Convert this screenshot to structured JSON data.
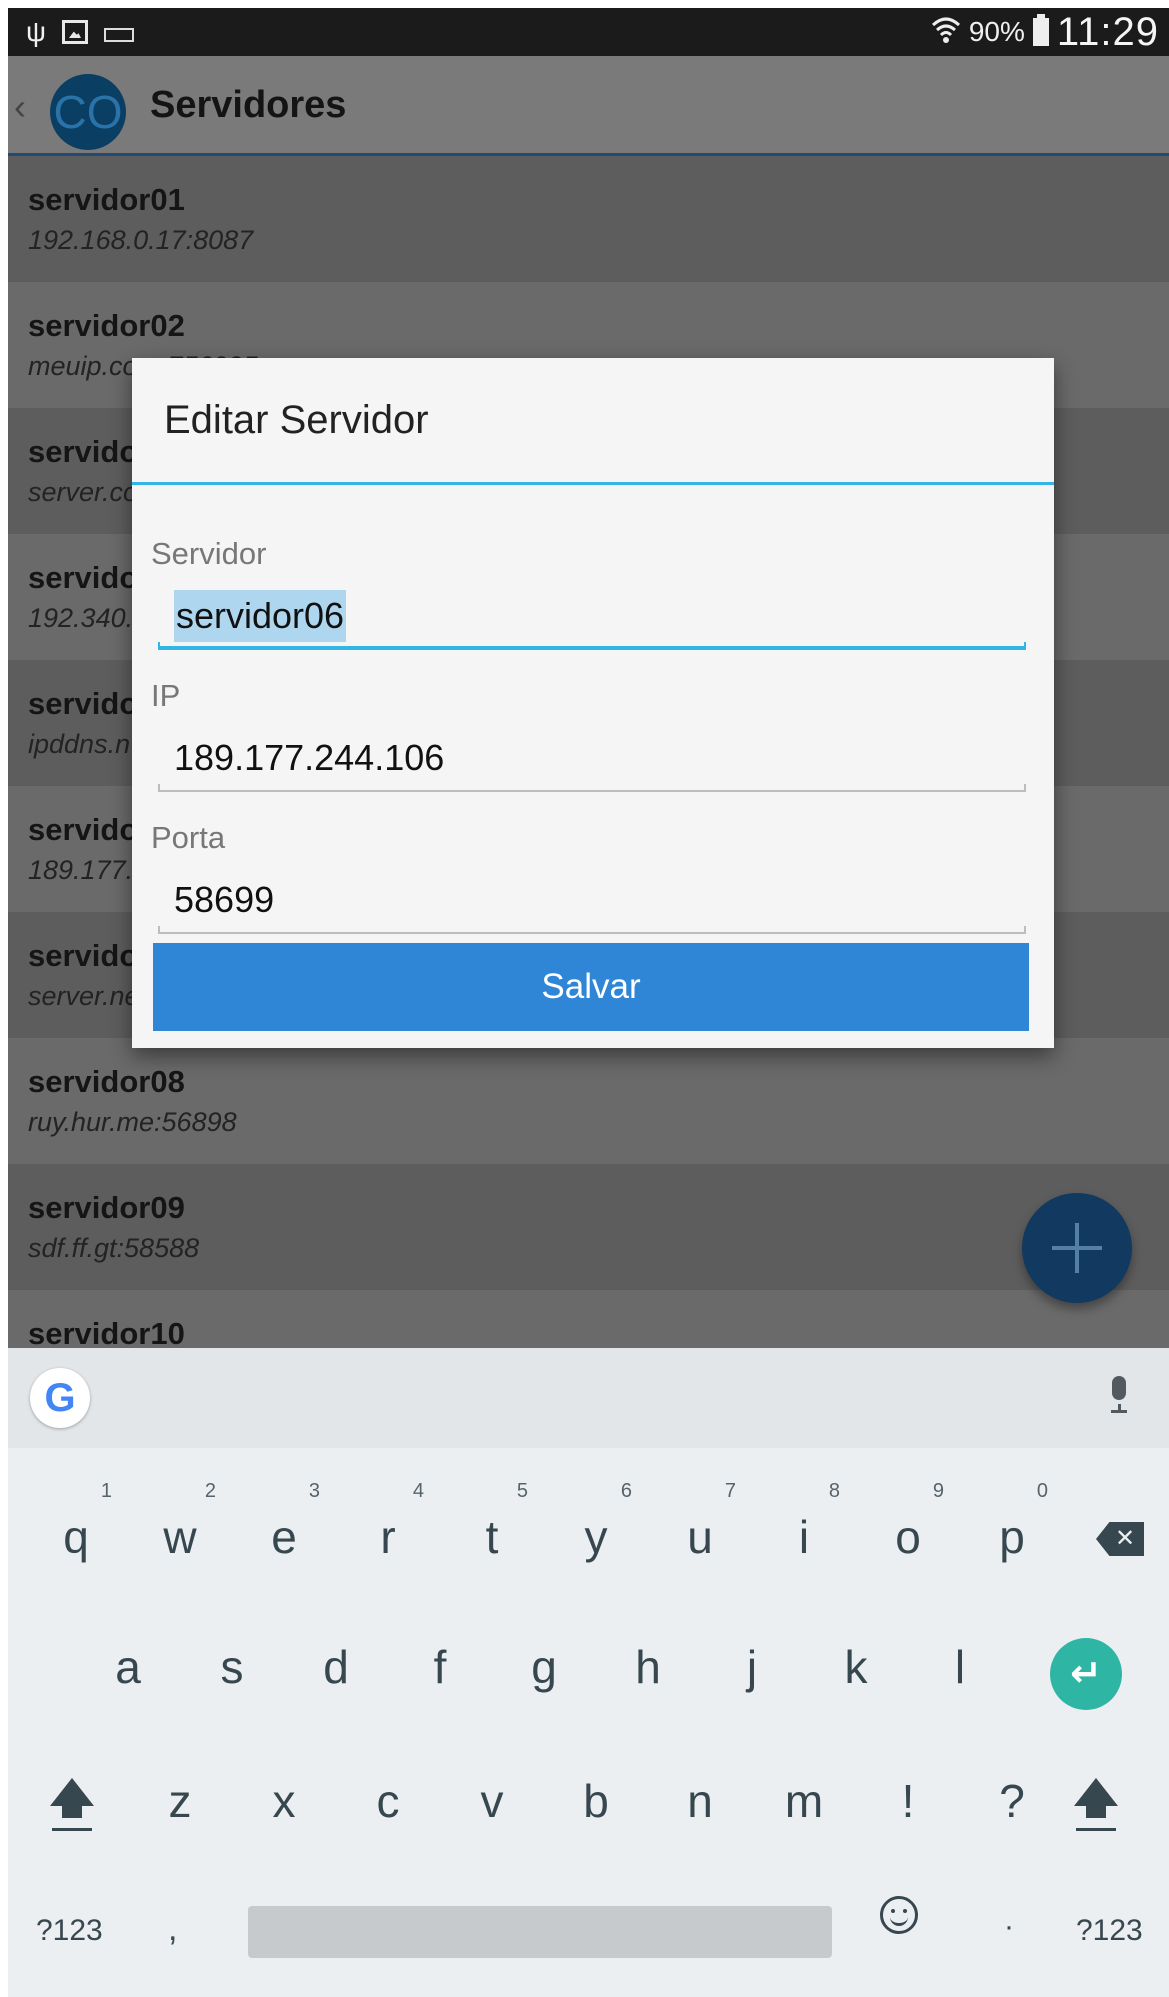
{
  "status_bar": {
    "battery": "90%",
    "time": "11:29",
    "icons": [
      "usb-icon",
      "image-icon",
      "keyboard-icon",
      "wifi-icon",
      "battery-icon"
    ]
  },
  "app_bar": {
    "logo_text": "CO",
    "title": "Servidores"
  },
  "servers": [
    {
      "name": "servidor01",
      "address": "192.168.0.17:8087"
    },
    {
      "name": "servidor02",
      "address": "meuip.com:756995"
    },
    {
      "name": "servidor03",
      "address": "server.com"
    },
    {
      "name": "servidor04",
      "address": "192.340."
    },
    {
      "name": "servidor05",
      "address": "ipddns.n"
    },
    {
      "name": "servidor06",
      "address": "189.177."
    },
    {
      "name": "servidor07",
      "address": "server.ne"
    },
    {
      "name": "servidor08",
      "address": "ruy.hur.me:56898"
    },
    {
      "name": "servidor09",
      "address": "sdf.ff.gt:58588"
    },
    {
      "name": "servidor10",
      "address": ""
    }
  ],
  "dialog": {
    "title": "Editar Servidor",
    "server_label": "Servidor",
    "server_value": "servidor06",
    "ip_label": "IP",
    "ip_value": "189.177.244.106",
    "port_label": "Porta",
    "port_value": "58699",
    "save_label": "Salvar"
  },
  "keyboard": {
    "row1": [
      {
        "k": "q",
        "h": "1"
      },
      {
        "k": "w",
        "h": "2"
      },
      {
        "k": "e",
        "h": "3"
      },
      {
        "k": "r",
        "h": "4"
      },
      {
        "k": "t",
        "h": "5"
      },
      {
        "k": "y",
        "h": "6"
      },
      {
        "k": "u",
        "h": "7"
      },
      {
        "k": "i",
        "h": "8"
      },
      {
        "k": "o",
        "h": "9"
      },
      {
        "k": "p",
        "h": "0"
      }
    ],
    "row2": [
      "a",
      "s",
      "d",
      "f",
      "g",
      "h",
      "j",
      "k",
      "l"
    ],
    "row3": [
      "z",
      "x",
      "c",
      "v",
      "b",
      "n",
      "m",
      "!",
      "?"
    ],
    "symbols_label": "?123",
    "comma": ",",
    "period": "·",
    "enter_symbol": "↵",
    "backspace_symbol": "✕",
    "google_logo": "G"
  },
  "colors": {
    "accent": "#33b5e5",
    "save_button": "#2f86d6",
    "fab": "#123960",
    "enter": "#2fb5a4"
  }
}
